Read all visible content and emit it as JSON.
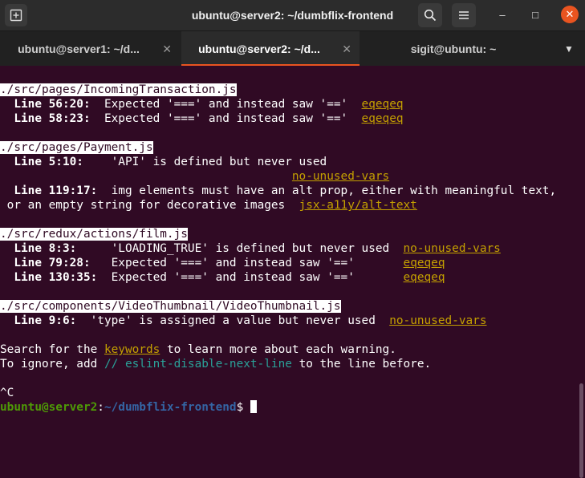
{
  "window": {
    "title": "ubuntu@server2: ~/dumbflix-frontend",
    "new_tab_icon": "new-tab-icon",
    "search_icon": "search-icon",
    "menu_icon": "hamburger-menu-icon",
    "minimize": "–",
    "maximize": "□",
    "close": "✕"
  },
  "tabs": [
    {
      "label": "ubuntu@server1: ~/d...",
      "close": "✕",
      "active": false
    },
    {
      "label": "ubuntu@server2: ~/d...",
      "close": "✕",
      "active": true
    },
    {
      "label": "sigit@ubuntu: ~",
      "close": "",
      "active": false
    }
  ],
  "tab_menu_icon": "▼",
  "terminal": {
    "files": [
      {
        "path": "./src/pages/IncomingTransaction.js"
      },
      {
        "path": "./src/pages/Payment.js"
      },
      {
        "path": "./src/redux/actions/film.js"
      },
      {
        "path": "./src/components/VideoThumbnail/VideoThumbnail.js"
      }
    ],
    "warnings": {
      "f1l1": {
        "loc": "  Line 56:20:",
        "msg": "  Expected '===' and instead saw '=='  ",
        "rule": "eqeqeq"
      },
      "f1l2": {
        "loc": "  Line 58:23:",
        "msg": "  Expected '===' and instead saw '=='  ",
        "rule": "eqeqeq"
      },
      "f2l1": {
        "loc": "  Line 5:10:",
        "msg": "    'API' is defined but never used"
      },
      "f2l1rule": {
        "pad": "                                          ",
        "rule": "no-unused-vars"
      },
      "f2l2": {
        "loc": "  Line 119:17:",
        "msg": "  img elements must have an alt prop, either with meaningful text,"
      },
      "f2l2b": {
        "msg": " or an empty string for decorative images  ",
        "rule": "jsx-a11y/alt-text"
      },
      "f3l1": {
        "loc": "  Line 8:3:",
        "msg": "     'LOADING_TRUE' is defined but never used  ",
        "rule": "no-unused-vars"
      },
      "f3l2": {
        "loc": "  Line 79:28:",
        "msg": "   Expected '===' and instead saw '=='       ",
        "rule": "eqeqeq"
      },
      "f3l3": {
        "loc": "  Line 130:35:",
        "msg": "  Expected '===' and instead saw '=='       ",
        "rule": "eqeqeq"
      },
      "f4l1": {
        "loc": "  Line 9:6:",
        "msg": "  'type' is assigned a value but never used  ",
        "rule": "no-unused-vars"
      }
    },
    "footer1": {
      "pre": "Search for the ",
      "kw": "keywords",
      "post": " to learn more about each warning."
    },
    "footer2": {
      "pre": "To ignore, add ",
      "kw": "// eslint-disable-next-line",
      "post": " to the line before."
    },
    "ctrl_c": "^C",
    "prompt": {
      "user": "ubuntu@server2",
      "sep": ":",
      "path": "~/dumbflix-frontend",
      "sym": "$ "
    }
  },
  "colors": {
    "bg": "#300a24",
    "accent": "#e95420",
    "rule": "#c4a000"
  }
}
